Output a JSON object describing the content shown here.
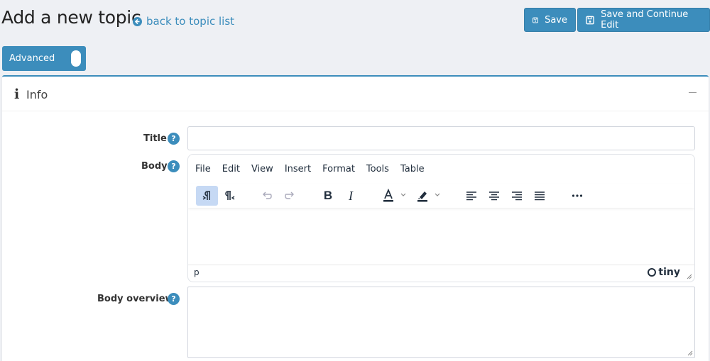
{
  "header": {
    "title": "Add a new topic",
    "back_link": "back to topic list",
    "save_label": "Save",
    "save_continue_label": "Save and Continue Edit"
  },
  "advanced_toggle": {
    "label": "Advanced",
    "state": "on"
  },
  "card": {
    "title": "Info"
  },
  "form": {
    "title_label": "Title",
    "title_value": "",
    "body_label": "Body",
    "body_overview_label": "Body overview",
    "body_overview_value": "",
    "help_glyph": "?"
  },
  "editor": {
    "menu": [
      "File",
      "Edit",
      "View",
      "Insert",
      "Format",
      "Tools",
      "Table"
    ],
    "status_path": "p",
    "brand": "tiny",
    "toolbar_icons": [
      "ltr-icon",
      "rtl-icon",
      "undo-icon",
      "redo-icon",
      "bold-icon",
      "italic-icon",
      "text-color-icon",
      "highlight-icon",
      "align-left-icon",
      "align-center-icon",
      "align-right-icon",
      "justify-icon",
      "more-icon"
    ]
  },
  "colors": {
    "accent": "#3c8dbc",
    "background": "#eef0f4"
  }
}
